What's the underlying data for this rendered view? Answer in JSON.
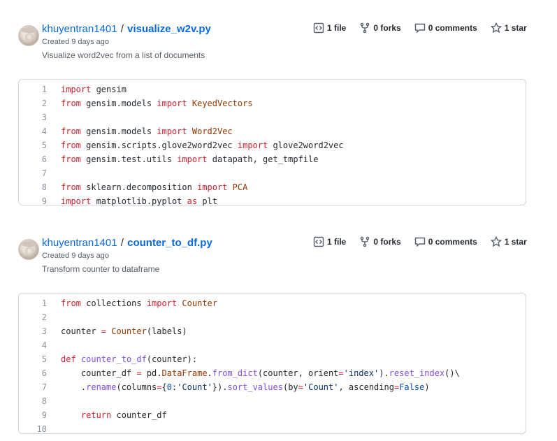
{
  "gists": [
    {
      "owner": "khuyentran1401",
      "separator": "/",
      "filename": "visualize_w2v.py",
      "created": "Created 9 days ago",
      "description": "Visualize word2vec from a list of documents",
      "stats": {
        "files": "1 file",
        "forks": "0 forks",
        "comments": "0 comments",
        "stars": "1 star"
      },
      "lines": [
        {
          "n": "1",
          "tokens": [
            [
              "kw",
              "import"
            ],
            [
              "t",
              " gensim"
            ]
          ]
        },
        {
          "n": "2",
          "tokens": [
            [
              "kw",
              "from"
            ],
            [
              "t",
              " gensim.models "
            ],
            [
              "kw",
              "import"
            ],
            [
              "t",
              " "
            ],
            [
              "cls",
              "KeyedVectors"
            ]
          ]
        },
        {
          "n": "3",
          "tokens": []
        },
        {
          "n": "4",
          "tokens": [
            [
              "kw",
              "from"
            ],
            [
              "t",
              " gensim.models "
            ],
            [
              "kw",
              "import"
            ],
            [
              "t",
              " "
            ],
            [
              "cls",
              "Word2Vec"
            ]
          ]
        },
        {
          "n": "5",
          "tokens": [
            [
              "kw",
              "from"
            ],
            [
              "t",
              " gensim.scripts.glove2word2vec "
            ],
            [
              "kw",
              "import"
            ],
            [
              "t",
              " glove2word2vec"
            ]
          ]
        },
        {
          "n": "6",
          "tokens": [
            [
              "kw",
              "from"
            ],
            [
              "t",
              " gensim.test.utils "
            ],
            [
              "kw",
              "import"
            ],
            [
              "t",
              " datapath, get_tmpfile"
            ]
          ]
        },
        {
          "n": "7",
          "tokens": []
        },
        {
          "n": "8",
          "tokens": [
            [
              "kw",
              "from"
            ],
            [
              "t",
              " sklearn.decomposition "
            ],
            [
              "kw",
              "import"
            ],
            [
              "t",
              " "
            ],
            [
              "cls",
              "PCA"
            ]
          ]
        },
        {
          "n": "9",
          "tokens": [
            [
              "kw",
              "import"
            ],
            [
              "t",
              " matplotlib.pyplot "
            ],
            [
              "kw",
              "as"
            ],
            [
              "t",
              " plt"
            ]
          ]
        }
      ]
    },
    {
      "owner": "khuyentran1401",
      "separator": "/",
      "filename": "counter_to_df.py",
      "created": "Created 9 days ago",
      "description": "Transform counter to dataframe",
      "stats": {
        "files": "1 file",
        "forks": "0 forks",
        "comments": "0 comments",
        "stars": "1 star"
      },
      "lines": [
        {
          "n": "1",
          "tokens": [
            [
              "kw",
              "from"
            ],
            [
              "t",
              " collections "
            ],
            [
              "kw",
              "import"
            ],
            [
              "t",
              " "
            ],
            [
              "cls",
              "Counter"
            ]
          ]
        },
        {
          "n": "2",
          "tokens": []
        },
        {
          "n": "3",
          "tokens": [
            [
              "t",
              "counter "
            ],
            [
              "kw",
              "="
            ],
            [
              "t",
              " "
            ],
            [
              "cls",
              "Counter"
            ],
            [
              "t",
              "(labels)"
            ]
          ]
        },
        {
          "n": "4",
          "tokens": []
        },
        {
          "n": "5",
          "tokens": [
            [
              "kw",
              "def"
            ],
            [
              "t",
              " "
            ],
            [
              "fn",
              "counter_to_df"
            ],
            [
              "t",
              "(counter):"
            ]
          ]
        },
        {
          "n": "6",
          "tokens": [
            [
              "t",
              "    counter_df "
            ],
            [
              "kw",
              "="
            ],
            [
              "t",
              " pd."
            ],
            [
              "cls",
              "DataFrame"
            ],
            [
              "t",
              "."
            ],
            [
              "fn",
              "from_dict"
            ],
            [
              "t",
              "(counter, orient"
            ],
            [
              "kw",
              "="
            ],
            [
              "str",
              "'index'"
            ],
            [
              "t",
              ")."
            ],
            [
              "fn",
              "reset_index"
            ],
            [
              "t",
              "()\\"
            ]
          ]
        },
        {
          "n": "7",
          "tokens": [
            [
              "t",
              "    ."
            ],
            [
              "fn",
              "rename"
            ],
            [
              "t",
              "(columns"
            ],
            [
              "kw",
              "="
            ],
            [
              "t",
              "{"
            ],
            [
              "num",
              "0"
            ],
            [
              "t",
              ":"
            ],
            [
              "str",
              "'Count'"
            ],
            [
              "t",
              "})."
            ],
            [
              "fn",
              "sort_values"
            ],
            [
              "t",
              "(by"
            ],
            [
              "kw",
              "="
            ],
            [
              "str",
              "'Count'"
            ],
            [
              "t",
              ", ascending"
            ],
            [
              "kw",
              "="
            ],
            [
              "num",
              "False"
            ],
            [
              "t",
              ")"
            ]
          ]
        },
        {
          "n": "8",
          "tokens": []
        },
        {
          "n": "9",
          "tokens": [
            [
              "t",
              "    "
            ],
            [
              "kw",
              "return"
            ],
            [
              "t",
              " counter_df"
            ]
          ]
        },
        {
          "n": "10",
          "tokens": []
        }
      ]
    }
  ],
  "icons": {
    "files": "code-file-icon",
    "forks": "fork-icon",
    "comments": "comment-icon",
    "stars": "star-icon"
  }
}
